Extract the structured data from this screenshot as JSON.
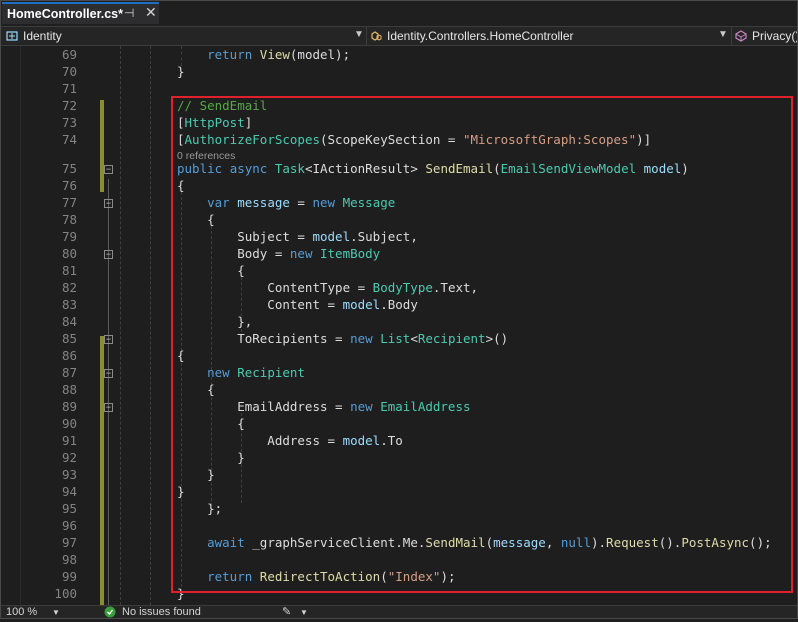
{
  "tab": {
    "title": "HomeController.cs*",
    "pin_icon": "pin-icon",
    "close_icon": "close-icon"
  },
  "navbar": {
    "project": "Identity",
    "class": "Identity.Controllers.HomeController",
    "member": "Privacy()"
  },
  "editor": {
    "codelens": "0 references",
    "lines": [
      {
        "n": "69",
        "tokens": [
          {
            "t": "    "
          },
          {
            "k": "kw",
            "t": "return"
          },
          {
            "t": " "
          },
          {
            "k": "m",
            "t": "View"
          },
          {
            "t": "(model);"
          }
        ]
      },
      {
        "n": "70",
        "tokens": [
          {
            "t": "}"
          }
        ]
      },
      {
        "n": "71",
        "tokens": []
      },
      {
        "n": "72",
        "tokens": [
          {
            "k": "cmt",
            "t": "// SendEmail"
          }
        ]
      },
      {
        "n": "73",
        "tokens": [
          {
            "t": "["
          },
          {
            "k": "type",
            "t": "HttpPost"
          },
          {
            "t": "]"
          }
        ]
      },
      {
        "n": "74",
        "tokens": [
          {
            "t": "["
          },
          {
            "k": "type",
            "t": "AuthorizeForScopes"
          },
          {
            "t": "(ScopeKeySection = "
          },
          {
            "k": "str",
            "t": "\"MicrosoftGraph:Scopes\""
          },
          {
            "t": ")]"
          }
        ]
      },
      {
        "n": "75",
        "tokens": [
          {
            "k": "kw",
            "t": "public"
          },
          {
            "t": " "
          },
          {
            "k": "kw",
            "t": "async"
          },
          {
            "t": " "
          },
          {
            "k": "type",
            "t": "Task"
          },
          {
            "t": "<IActionResult> "
          },
          {
            "k": "m",
            "t": "SendEmail"
          },
          {
            "t": "("
          },
          {
            "k": "type",
            "t": "EmailSendViewModel"
          },
          {
            "t": " "
          },
          {
            "k": "p",
            "t": "model"
          },
          {
            "t": ")"
          }
        ]
      },
      {
        "n": "76",
        "tokens": [
          {
            "t": "{"
          }
        ]
      },
      {
        "n": "77",
        "tokens": [
          {
            "t": "    "
          },
          {
            "k": "kw",
            "t": "var"
          },
          {
            "t": " "
          },
          {
            "k": "p",
            "t": "message"
          },
          {
            "t": " = "
          },
          {
            "k": "kw",
            "t": "new"
          },
          {
            "t": " "
          },
          {
            "k": "type",
            "t": "Message"
          }
        ]
      },
      {
        "n": "78",
        "tokens": [
          {
            "t": "    {"
          }
        ]
      },
      {
        "n": "79",
        "tokens": [
          {
            "t": "        Subject = "
          },
          {
            "k": "p",
            "t": "model"
          },
          {
            "t": ".Subject,"
          }
        ]
      },
      {
        "n": "80",
        "tokens": [
          {
            "t": "        Body = "
          },
          {
            "k": "kw",
            "t": "new"
          },
          {
            "t": " "
          },
          {
            "k": "type",
            "t": "ItemBody"
          }
        ]
      },
      {
        "n": "81",
        "tokens": [
          {
            "t": "        {"
          }
        ]
      },
      {
        "n": "82",
        "tokens": [
          {
            "t": "            ContentType = "
          },
          {
            "k": "type",
            "t": "BodyType"
          },
          {
            "t": ".Text,"
          }
        ]
      },
      {
        "n": "83",
        "tokens": [
          {
            "t": "            Content = "
          },
          {
            "k": "p",
            "t": "model"
          },
          {
            "t": ".Body"
          }
        ]
      },
      {
        "n": "84",
        "tokens": [
          {
            "t": "        },"
          }
        ]
      },
      {
        "n": "85",
        "tokens": [
          {
            "t": "        ToRecipients = "
          },
          {
            "k": "kw",
            "t": "new"
          },
          {
            "t": " "
          },
          {
            "k": "type",
            "t": "List"
          },
          {
            "t": "<"
          },
          {
            "k": "type",
            "t": "Recipient"
          },
          {
            "t": ">()"
          }
        ]
      },
      {
        "n": "86",
        "tokens": [
          {
            "t": "{"
          }
        ]
      },
      {
        "n": "87",
        "tokens": [
          {
            "t": "    "
          },
          {
            "k": "kw",
            "t": "new"
          },
          {
            "t": " "
          },
          {
            "k": "type",
            "t": "Recipient"
          }
        ]
      },
      {
        "n": "88",
        "tokens": [
          {
            "t": "    {"
          }
        ]
      },
      {
        "n": "89",
        "tokens": [
          {
            "t": "        EmailAddress = "
          },
          {
            "k": "kw",
            "t": "new"
          },
          {
            "t": " "
          },
          {
            "k": "type",
            "t": "EmailAddress"
          }
        ]
      },
      {
        "n": "90",
        "tokens": [
          {
            "t": "        {"
          }
        ]
      },
      {
        "n": "91",
        "tokens": [
          {
            "t": "            Address = "
          },
          {
            "k": "p",
            "t": "model"
          },
          {
            "t": ".To"
          }
        ]
      },
      {
        "n": "92",
        "tokens": [
          {
            "t": "        }"
          }
        ]
      },
      {
        "n": "93",
        "tokens": [
          {
            "t": "    }"
          }
        ]
      },
      {
        "n": "94",
        "tokens": [
          {
            "t": "}"
          }
        ]
      },
      {
        "n": "95",
        "tokens": [
          {
            "t": "    };"
          }
        ]
      },
      {
        "n": "96",
        "tokens": []
      },
      {
        "n": "97",
        "tokens": [
          {
            "t": "    "
          },
          {
            "k": "kw",
            "t": "await"
          },
          {
            "t": " _graphServiceClient.Me."
          },
          {
            "k": "m",
            "t": "SendMail"
          },
          {
            "t": "("
          },
          {
            "k": "p",
            "t": "message"
          },
          {
            "t": ", "
          },
          {
            "k": "kw",
            "t": "null"
          },
          {
            "t": ")."
          },
          {
            "k": "m",
            "t": "Request"
          },
          {
            "t": "()."
          },
          {
            "k": "m",
            "t": "PostAsync"
          },
          {
            "t": "();"
          }
        ]
      },
      {
        "n": "98",
        "tokens": []
      },
      {
        "n": "99",
        "tokens": [
          {
            "t": "    "
          },
          {
            "k": "kw",
            "t": "return"
          },
          {
            "t": " "
          },
          {
            "k": "m",
            "t": "RedirectToAction"
          },
          {
            "t": "("
          },
          {
            "k": "str",
            "t": "\"Index\""
          },
          {
            "t": ");"
          }
        ]
      },
      {
        "n": "100",
        "tokens": [
          {
            "t": "}"
          }
        ]
      }
    ]
  },
  "status": {
    "zoom": "100 %",
    "issues": "No issues found"
  },
  "colors": {
    "keyword": "#569cd6",
    "type": "#4ec9b0",
    "string": "#d69d85",
    "comment": "#57a64a",
    "method": "#dcdcaa",
    "parameter": "#9cdcfe",
    "text": "#dcdcdc",
    "highlight_border": "#e0202a",
    "tab_accent": "#1e6ec8",
    "change_bar": "#8c8c32"
  }
}
